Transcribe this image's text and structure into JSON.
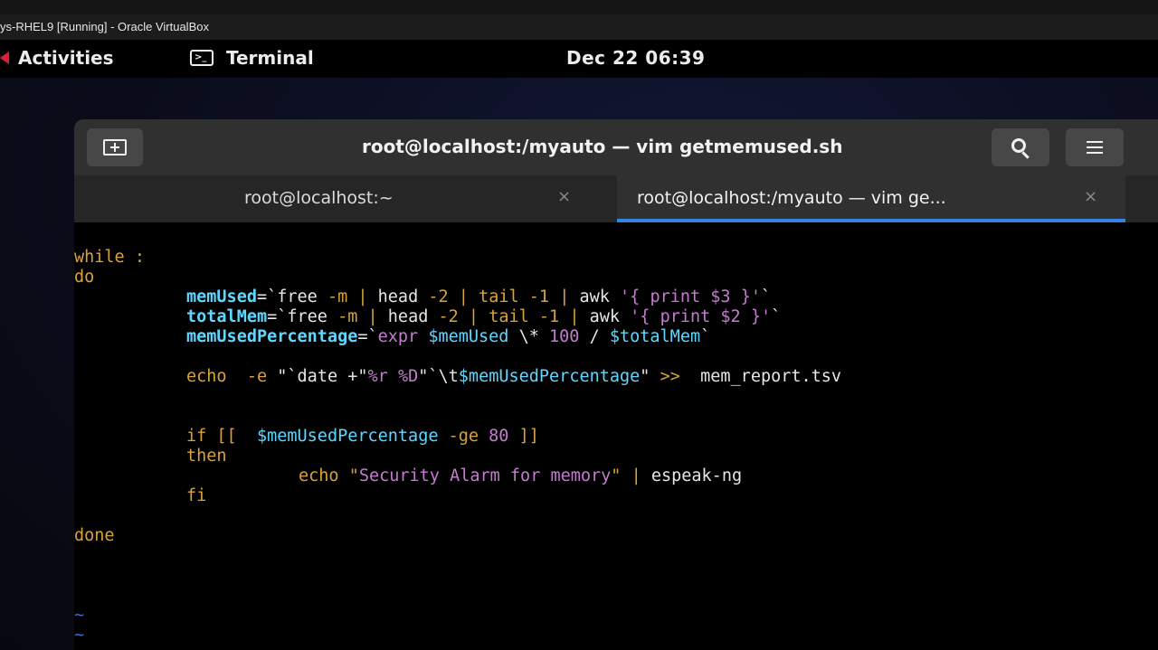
{
  "vbox": {
    "title": "ys-RHEL9 [Running] - Oracle VirtualBox"
  },
  "topbar": {
    "activities": "Activities",
    "app_name": "Terminal",
    "clock": "Dec 22  06:39"
  },
  "terminal": {
    "window_title": "root@localhost:/myauto — vim getmemused.sh",
    "tabs": [
      {
        "label": "root@localhost:~",
        "active": false
      },
      {
        "label": "root@localhost:/myauto — vim ge...",
        "active": true
      }
    ],
    "close_glyph": "×",
    "accent_color": "#3584e4"
  },
  "vim": {
    "l_while_kw": "while",
    "l_while_colon": ":",
    "l_do": "do",
    "l3_var": "memUsed",
    "l3_eq": "=`",
    "l3_free": "free",
    "l3_m": "-m",
    "l3_p1": "|",
    "l3_head": "head",
    "l3_n2": "-2",
    "l3_p2": "|",
    "l3_tail": "tail",
    "l3_n1": "-1",
    "l3_p3": "|",
    "l3_awk": "awk",
    "l3_str": "'{ print $3 }'",
    "l3_end": "`",
    "l4_var": "totalMem",
    "l4_eq": "=`",
    "l4_free": "free",
    "l4_m": "-m",
    "l4_p1": "|",
    "l4_head": "head",
    "l4_n2": "-2",
    "l4_p2": "|",
    "l4_tail": "tail",
    "l4_n1": "-1",
    "l4_p3": "|",
    "l4_awk": "awk",
    "l4_str": "'{ print $2 }'",
    "l4_end": "`",
    "l5_var": "memUsedPercentage",
    "l5_eq": "=`",
    "l5_expr": "expr",
    "l5_v1": "$memUsed",
    "l5_star": "\\*",
    "l5_100": "100",
    "l5_div": "/",
    "l5_v2": "$totalMem",
    "l5_end": "`",
    "l6_echo": "echo",
    "l6_e": "-e",
    "l6_q1": "\"`",
    "l6_date": "date",
    "l6_plus": "+\"",
    "l6_fmt": "%r %D",
    "l6_q2": "\"`",
    "l6_tab": "\\t",
    "l6_var": "$memUsedPercentage",
    "l6_q3": "\"",
    "l6_redir": ">>",
    "l6_file": "mem_report.tsv",
    "l7_if": "if [[",
    "l7_var": "$memUsedPercentage",
    "l7_ge": "-ge",
    "l7_80": "80",
    "l7_close": "]]",
    "l8_then": "then",
    "l9_echo": "echo",
    "l9_q1": "\"",
    "l9_str": "Security Alarm for memory",
    "l9_q2": "\"",
    "l9_pipe": "|",
    "l9_cmd": "espeak-ng",
    "l10_fi": "fi",
    "l11_done": "done",
    "tilde": "~"
  }
}
